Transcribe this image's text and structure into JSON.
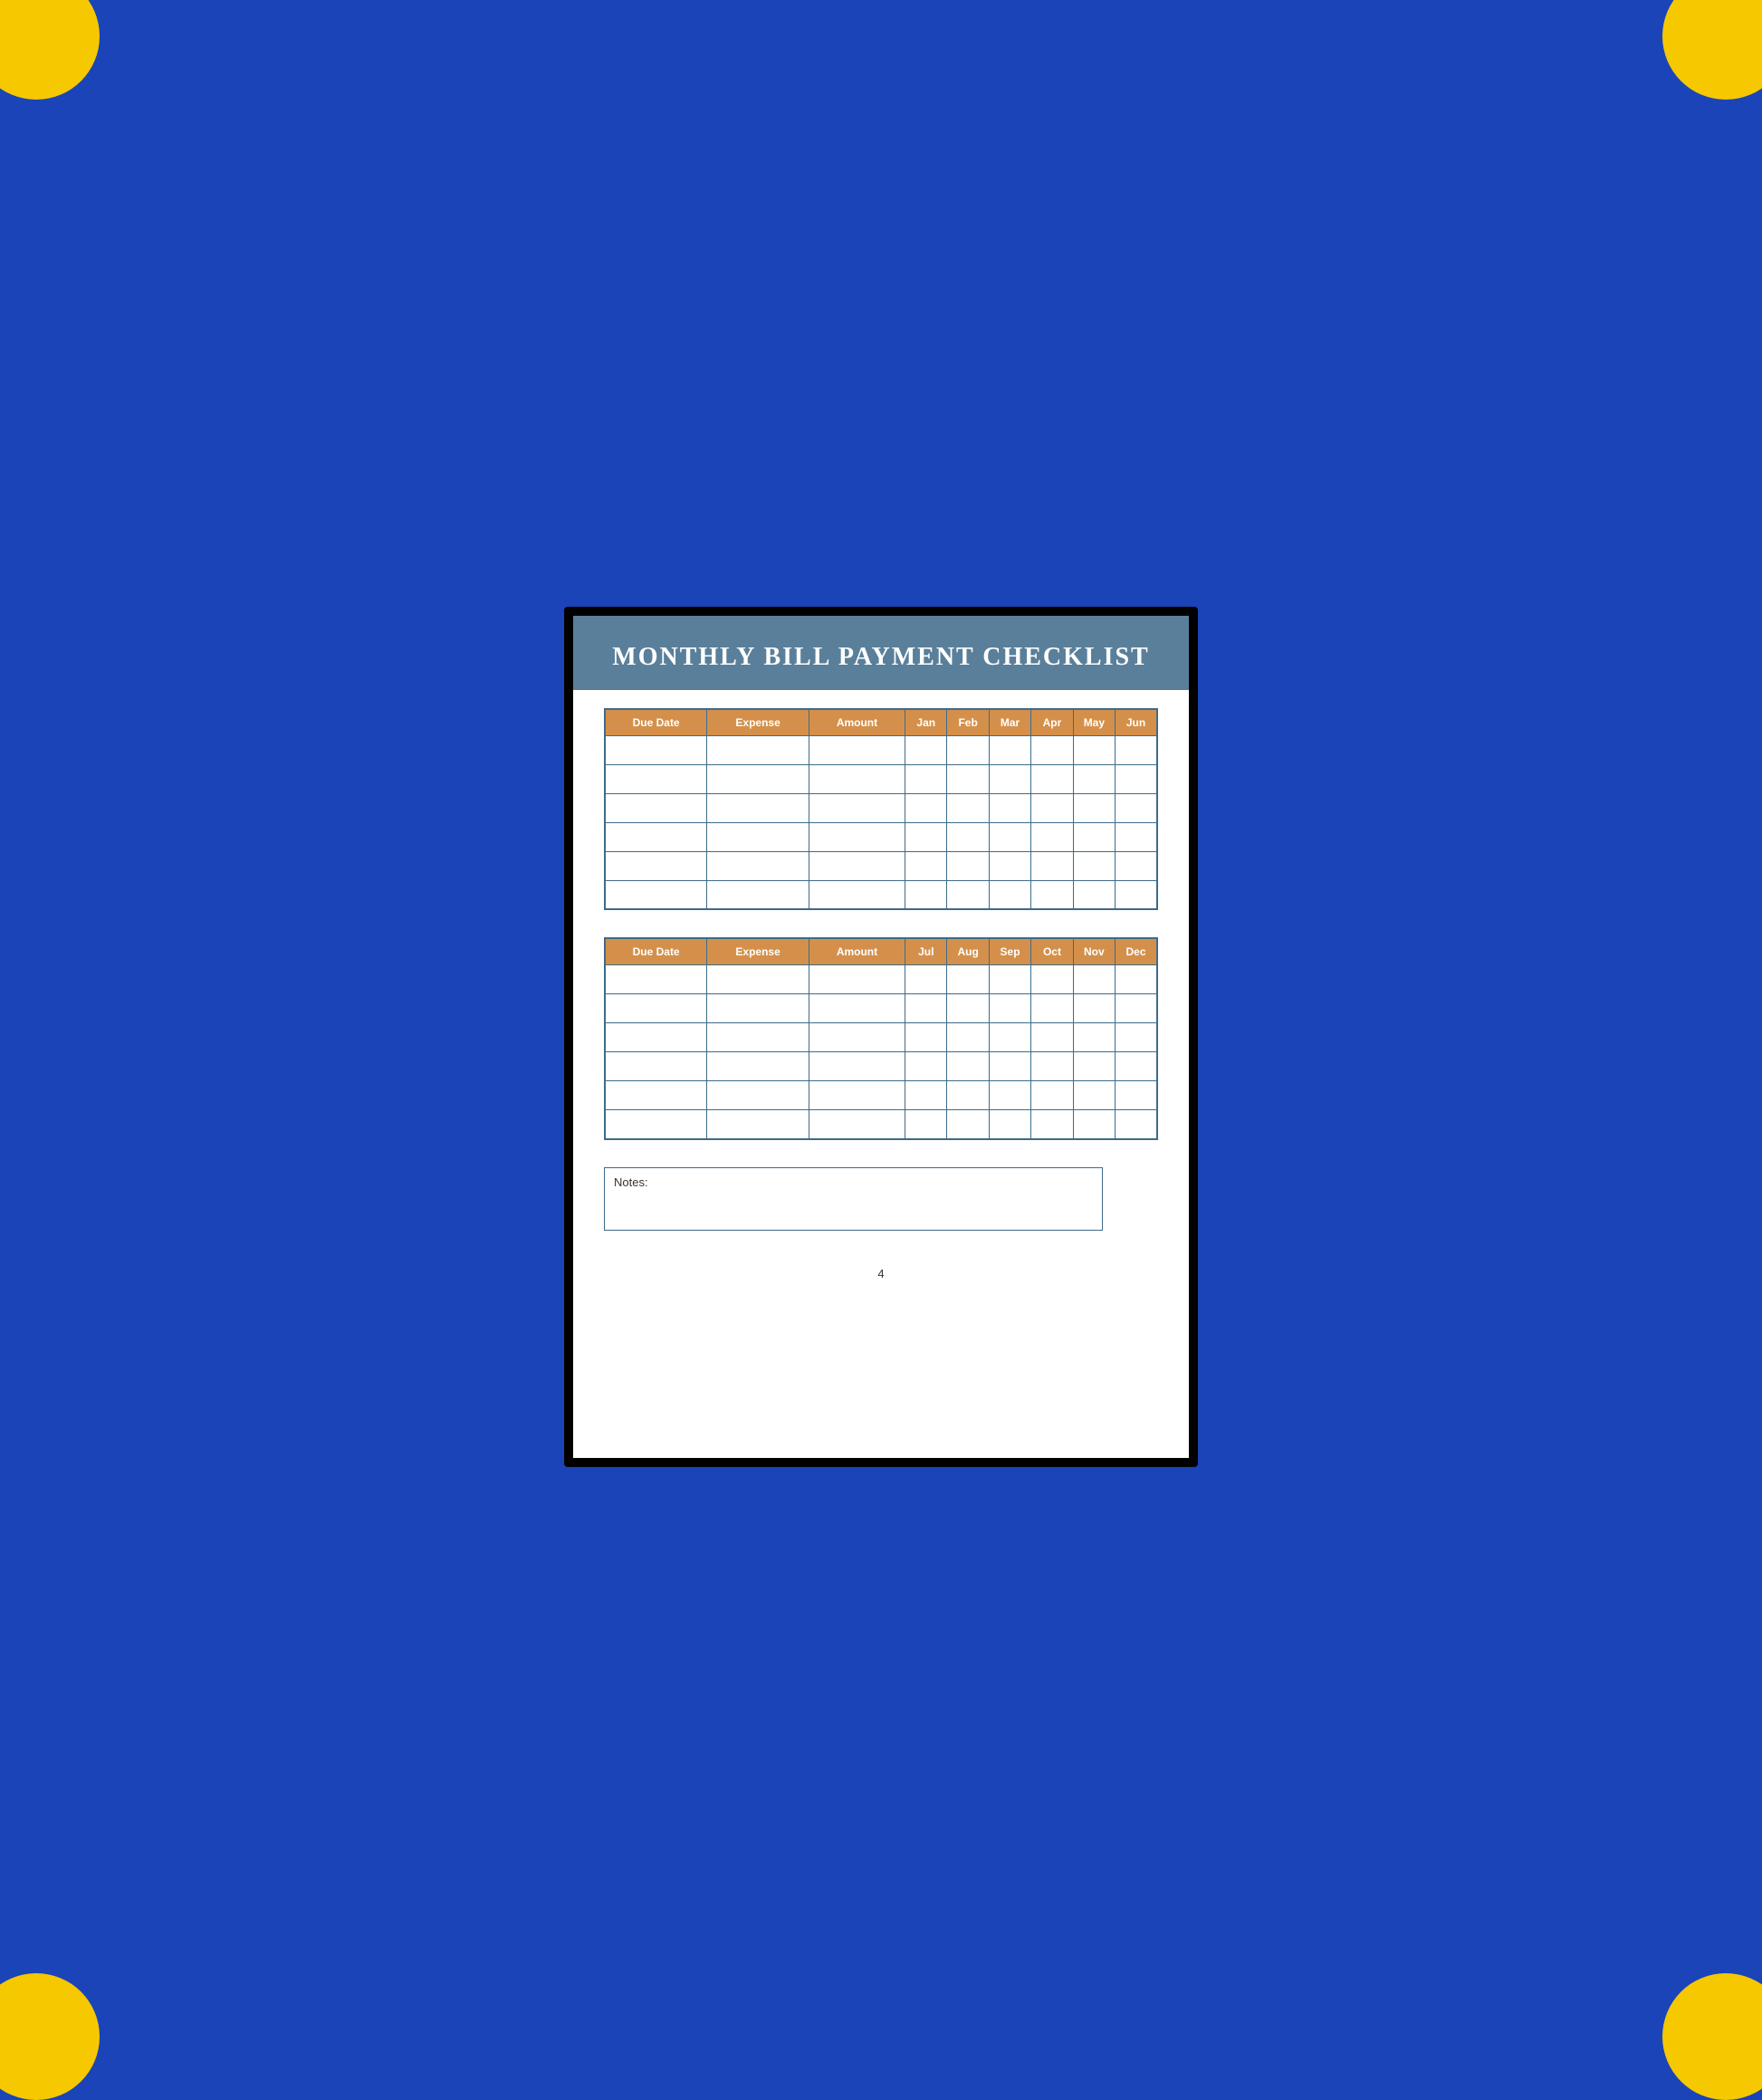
{
  "background": {
    "outer_color": "#1a44b8",
    "corner_color": "#f5c800"
  },
  "page": {
    "title": "MONTHLY BILL PAYMENT CHECKLIST",
    "page_number": "4"
  },
  "header": {
    "background_color": "#5a7f9a",
    "title_color": "#ffffff"
  },
  "table_header_color": "#d4904a",
  "table_border_color": "#3d6b8a",
  "table1": {
    "columns": [
      "Due Date",
      "Expense",
      "Amount",
      "Jan",
      "Feb",
      "Mar",
      "Apr",
      "May",
      "Jun"
    ],
    "rows": 6
  },
  "table2": {
    "columns": [
      "Due Date",
      "Expense",
      "Amount",
      "Jul",
      "Aug",
      "Sep",
      "Oct",
      "Nov",
      "Dec"
    ],
    "rows": 6
  },
  "notes": {
    "label": "Notes:"
  }
}
